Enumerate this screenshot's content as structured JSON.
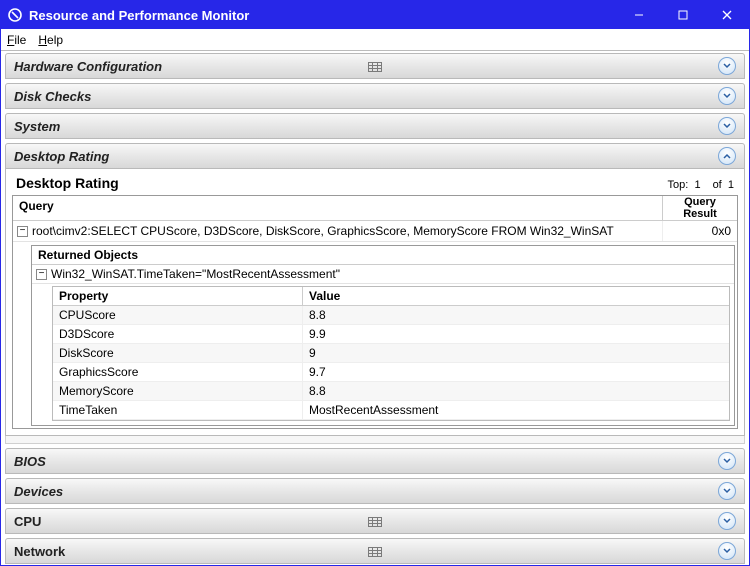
{
  "window": {
    "title": "Resource and Performance Monitor"
  },
  "menu": {
    "file": "File",
    "help": "Help"
  },
  "sections": {
    "hardware": "Hardware Configuration",
    "diskchecks": "Disk Checks",
    "system": "System",
    "desktop_rating": "Desktop Rating",
    "bios": "BIOS",
    "devices": "Devices",
    "cpu": "CPU",
    "network": "Network"
  },
  "desktop_panel": {
    "title": "Desktop Rating",
    "top_label": "Top:",
    "top_value": "1",
    "of_label": "of",
    "of_value": "1",
    "query_header": "Query",
    "query_result_header1": "Query",
    "query_result_header2": "Result",
    "query_text": "root\\cimv2:SELECT CPUScore, D3DScore, DiskScore, GraphicsScore, MemoryScore FROM Win32_WinSAT",
    "query_result": "0x0",
    "returned_header": "Returned Objects",
    "returned_row": "Win32_WinSAT.TimeTaken=\"MostRecentAssessment\"",
    "prop_header_property": "Property",
    "prop_header_value": "Value",
    "props": [
      {
        "property": "CPUScore",
        "value": "8.8"
      },
      {
        "property": "D3DScore",
        "value": "9.9"
      },
      {
        "property": "DiskScore",
        "value": "9"
      },
      {
        "property": "GraphicsScore",
        "value": "9.7"
      },
      {
        "property": "MemoryScore",
        "value": "8.8"
      },
      {
        "property": "TimeTaken",
        "value": "MostRecentAssessment"
      }
    ]
  }
}
